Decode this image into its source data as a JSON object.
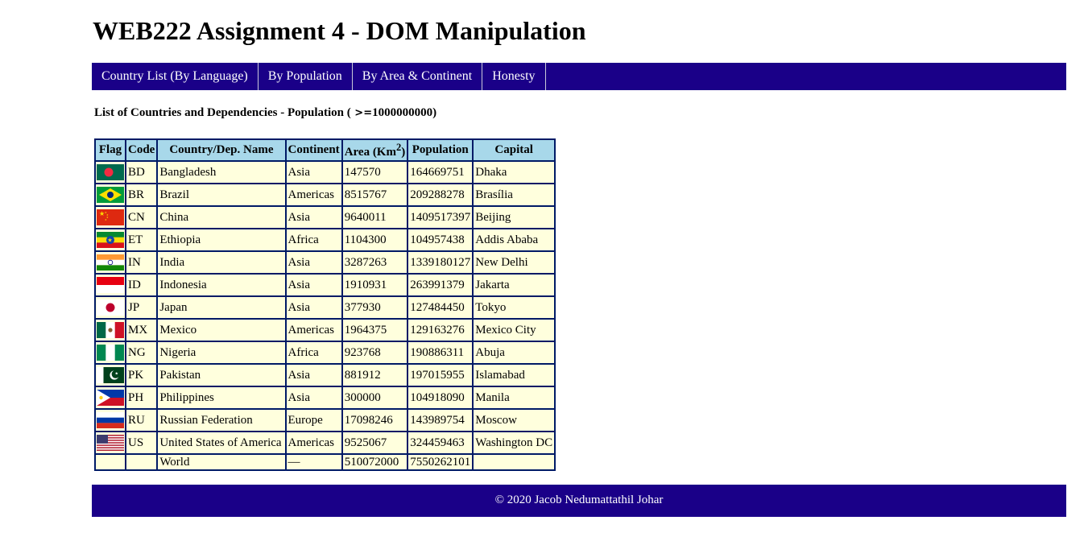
{
  "page": {
    "title": "WEB222 Assignment 4 - DOM Manipulation",
    "footer": "© 2020 Jacob Nedumattathil Johar"
  },
  "nav": {
    "items": [
      {
        "label": "Country List (By Language)"
      },
      {
        "label": "By Population"
      },
      {
        "label": "By Area & Continent"
      },
      {
        "label": "Honesty"
      }
    ]
  },
  "list": {
    "caption_prefix": "List of Countries and Dependencies - Population (",
    "caption_ops": " >=",
    "caption_value": "1000000000",
    "caption_suffix": ")"
  },
  "table": {
    "headers": {
      "flag": "Flag",
      "code": "Code",
      "name": "Country/Dep. Name",
      "continent": "Continent",
      "area": "Area (Km",
      "area_sup": "2",
      "area_close": ")",
      "population": "Population",
      "capital": "Capital"
    },
    "rows": [
      {
        "flag": "bangladesh-flag",
        "code": "BD",
        "name": "Bangladesh",
        "continent": "Asia",
        "area": "147570",
        "population": "164669751",
        "capital": "Dhaka"
      },
      {
        "flag": "brazil-flag",
        "code": "BR",
        "name": "Brazil",
        "continent": "Americas",
        "area": "8515767",
        "population": "209288278",
        "capital": "Brasília"
      },
      {
        "flag": "china-flag",
        "code": "CN",
        "name": "China",
        "continent": "Asia",
        "area": "9640011",
        "population": "1409517397",
        "capital": "Beijing"
      },
      {
        "flag": "ethiopia-flag",
        "code": "ET",
        "name": "Ethiopia",
        "continent": "Africa",
        "area": "1104300",
        "population": "104957438",
        "capital": "Addis Ababa"
      },
      {
        "flag": "india-flag",
        "code": "IN",
        "name": "India",
        "continent": "Asia",
        "area": "3287263",
        "population": "1339180127",
        "capital": "New Delhi"
      },
      {
        "flag": "indonesia-flag",
        "code": "ID",
        "name": "Indonesia",
        "continent": "Asia",
        "area": "1910931",
        "population": "263991379",
        "capital": "Jakarta"
      },
      {
        "flag": "japan-flag",
        "code": "JP",
        "name": "Japan",
        "continent": "Asia",
        "area": "377930",
        "population": "127484450",
        "capital": "Tokyo"
      },
      {
        "flag": "mexico-flag",
        "code": "MX",
        "name": "Mexico",
        "continent": "Americas",
        "area": "1964375",
        "population": "129163276",
        "capital": "Mexico City"
      },
      {
        "flag": "nigeria-flag",
        "code": "NG",
        "name": "Nigeria",
        "continent": "Africa",
        "area": "923768",
        "population": "190886311",
        "capital": "Abuja"
      },
      {
        "flag": "pakistan-flag",
        "code": "PK",
        "name": "Pakistan",
        "continent": "Asia",
        "area": "881912",
        "population": "197015955",
        "capital": "Islamabad"
      },
      {
        "flag": "philippines-flag",
        "code": "PH",
        "name": "Philippines",
        "continent": "Asia",
        "area": "300000",
        "population": "104918090",
        "capital": "Manila"
      },
      {
        "flag": "russia-flag",
        "code": "RU",
        "name": "Russian Federation",
        "continent": "Europe",
        "area": "17098246",
        "population": "143989754",
        "capital": "Moscow"
      },
      {
        "flag": "usa-flag",
        "code": "US",
        "name": "United States of America",
        "continent": "Americas",
        "area": "9525067",
        "population": "324459463",
        "capital": "Washington DC"
      }
    ],
    "world": {
      "name": "World",
      "continent": "—",
      "area": "510072000",
      "population": "7550262101"
    }
  },
  "colors": {
    "nav_bg": "#1a0088",
    "header_bg": "#a8d8ea",
    "cell_bg": "#ffffdd",
    "border": "#001a66"
  }
}
